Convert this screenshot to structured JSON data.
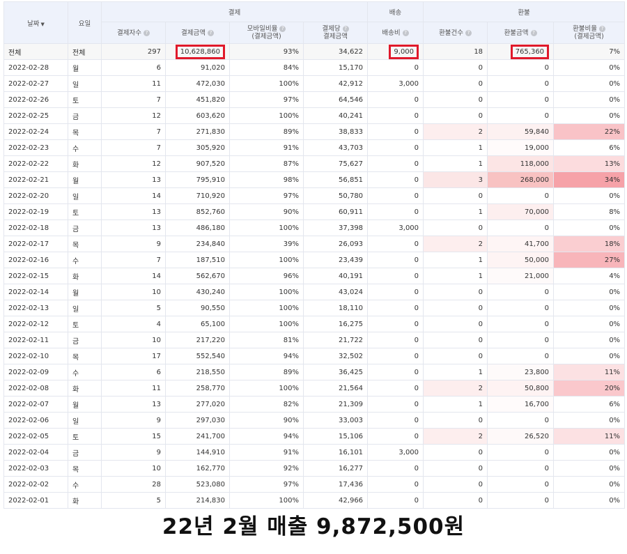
{
  "headers": {
    "date": "날짜",
    "weekday": "요일",
    "group_payment": "결제",
    "group_shipping": "배송",
    "group_refund": "환불",
    "payers": "결제자수",
    "payment_amount": "결제금액",
    "mobile_ratio_l1": "모바일비율",
    "mobile_ratio_l2": "(결제금액)",
    "per_payer_l1": "결제당",
    "per_payer_l2": "결제금액",
    "shipping_fee": "배송비",
    "refund_count": "환불건수",
    "refund_amount": "환불금액",
    "refund_ratio_l1": "환불비율",
    "refund_ratio_l2": "(결제금액)",
    "help_glyph": "?",
    "sort_glyph": "▼"
  },
  "colors": {
    "highlight_border": "#e0192b",
    "header_bg": "#eef2fb",
    "grid": "#e3e6ee"
  },
  "total": {
    "date": "전체",
    "weekday": "전체",
    "payers": "297",
    "amount": "10,628,860",
    "mobile": "93%",
    "per_payer": "34,622",
    "shipping": "9,000",
    "refund_count": "18",
    "refund_amount": "765,360",
    "refund_ratio": "7%"
  },
  "rows": [
    {
      "date": "2022-02-28",
      "weekday": "월",
      "payers": "6",
      "amount": "91,020",
      "mobile": "84%",
      "per_payer": "15,170",
      "shipping": "0",
      "refund_count": "0",
      "refund_amount": "0",
      "refund_ratio": "0%"
    },
    {
      "date": "2022-02-27",
      "weekday": "일",
      "payers": "11",
      "amount": "472,030",
      "mobile": "100%",
      "per_payer": "42,912",
      "shipping": "3,000",
      "refund_count": "0",
      "refund_amount": "0",
      "refund_ratio": "0%"
    },
    {
      "date": "2022-02-26",
      "weekday": "토",
      "payers": "7",
      "amount": "451,820",
      "mobile": "97%",
      "per_payer": "64,546",
      "shipping": "0",
      "refund_count": "0",
      "refund_amount": "0",
      "refund_ratio": "0%"
    },
    {
      "date": "2022-02-25",
      "weekday": "금",
      "payers": "12",
      "amount": "603,620",
      "mobile": "100%",
      "per_payer": "40,241",
      "shipping": "0",
      "refund_count": "0",
      "refund_amount": "0",
      "refund_ratio": "0%"
    },
    {
      "date": "2022-02-24",
      "weekday": "목",
      "payers": "7",
      "amount": "271,830",
      "mobile": "89%",
      "per_payer": "38,833",
      "shipping": "0",
      "refund_count": "2",
      "refund_amount": "59,840",
      "refund_ratio": "22%"
    },
    {
      "date": "2022-02-23",
      "weekday": "수",
      "payers": "7",
      "amount": "305,920",
      "mobile": "91%",
      "per_payer": "43,703",
      "shipping": "0",
      "refund_count": "1",
      "refund_amount": "19,000",
      "refund_ratio": "6%"
    },
    {
      "date": "2022-02-22",
      "weekday": "화",
      "payers": "12",
      "amount": "907,520",
      "mobile": "87%",
      "per_payer": "75,627",
      "shipping": "0",
      "refund_count": "1",
      "refund_amount": "118,000",
      "refund_ratio": "13%"
    },
    {
      "date": "2022-02-21",
      "weekday": "월",
      "payers": "13",
      "amount": "795,910",
      "mobile": "98%",
      "per_payer": "56,851",
      "shipping": "0",
      "refund_count": "3",
      "refund_amount": "268,000",
      "refund_ratio": "34%"
    },
    {
      "date": "2022-02-20",
      "weekday": "일",
      "payers": "14",
      "amount": "710,920",
      "mobile": "97%",
      "per_payer": "50,780",
      "shipping": "0",
      "refund_count": "0",
      "refund_amount": "0",
      "refund_ratio": "0%"
    },
    {
      "date": "2022-02-19",
      "weekday": "토",
      "payers": "13",
      "amount": "852,760",
      "mobile": "90%",
      "per_payer": "60,911",
      "shipping": "0",
      "refund_count": "1",
      "refund_amount": "70,000",
      "refund_ratio": "8%"
    },
    {
      "date": "2022-02-18",
      "weekday": "금",
      "payers": "13",
      "amount": "486,180",
      "mobile": "100%",
      "per_payer": "37,398",
      "shipping": "3,000",
      "refund_count": "0",
      "refund_amount": "0",
      "refund_ratio": "0%"
    },
    {
      "date": "2022-02-17",
      "weekday": "목",
      "payers": "9",
      "amount": "234,840",
      "mobile": "39%",
      "per_payer": "26,093",
      "shipping": "0",
      "refund_count": "2",
      "refund_amount": "41,700",
      "refund_ratio": "18%"
    },
    {
      "date": "2022-02-16",
      "weekday": "수",
      "payers": "7",
      "amount": "187,510",
      "mobile": "100%",
      "per_payer": "23,439",
      "shipping": "0",
      "refund_count": "1",
      "refund_amount": "50,000",
      "refund_ratio": "27%"
    },
    {
      "date": "2022-02-15",
      "weekday": "화",
      "payers": "14",
      "amount": "562,670",
      "mobile": "96%",
      "per_payer": "40,191",
      "shipping": "0",
      "refund_count": "1",
      "refund_amount": "21,000",
      "refund_ratio": "4%"
    },
    {
      "date": "2022-02-14",
      "weekday": "월",
      "payers": "10",
      "amount": "430,240",
      "mobile": "100%",
      "per_payer": "43,024",
      "shipping": "0",
      "refund_count": "0",
      "refund_amount": "0",
      "refund_ratio": "0%"
    },
    {
      "date": "2022-02-13",
      "weekday": "일",
      "payers": "5",
      "amount": "90,550",
      "mobile": "100%",
      "per_payer": "18,110",
      "shipping": "0",
      "refund_count": "0",
      "refund_amount": "0",
      "refund_ratio": "0%"
    },
    {
      "date": "2022-02-12",
      "weekday": "토",
      "payers": "4",
      "amount": "65,100",
      "mobile": "100%",
      "per_payer": "16,275",
      "shipping": "0",
      "refund_count": "0",
      "refund_amount": "0",
      "refund_ratio": "0%"
    },
    {
      "date": "2022-02-11",
      "weekday": "금",
      "payers": "10",
      "amount": "217,220",
      "mobile": "81%",
      "per_payer": "21,722",
      "shipping": "0",
      "refund_count": "0",
      "refund_amount": "0",
      "refund_ratio": "0%"
    },
    {
      "date": "2022-02-10",
      "weekday": "목",
      "payers": "17",
      "amount": "552,540",
      "mobile": "94%",
      "per_payer": "32,502",
      "shipping": "0",
      "refund_count": "0",
      "refund_amount": "0",
      "refund_ratio": "0%"
    },
    {
      "date": "2022-02-09",
      "weekday": "수",
      "payers": "6",
      "amount": "218,550",
      "mobile": "89%",
      "per_payer": "36,425",
      "shipping": "0",
      "refund_count": "1",
      "refund_amount": "23,800",
      "refund_ratio": "11%"
    },
    {
      "date": "2022-02-08",
      "weekday": "화",
      "payers": "11",
      "amount": "258,770",
      "mobile": "100%",
      "per_payer": "21,564",
      "shipping": "0",
      "refund_count": "2",
      "refund_amount": "50,800",
      "refund_ratio": "20%"
    },
    {
      "date": "2022-02-07",
      "weekday": "월",
      "payers": "13",
      "amount": "277,020",
      "mobile": "82%",
      "per_payer": "21,309",
      "shipping": "0",
      "refund_count": "1",
      "refund_amount": "16,700",
      "refund_ratio": "6%"
    },
    {
      "date": "2022-02-06",
      "weekday": "일",
      "payers": "9",
      "amount": "297,030",
      "mobile": "90%",
      "per_payer": "33,003",
      "shipping": "0",
      "refund_count": "0",
      "refund_amount": "0",
      "refund_ratio": "0%"
    },
    {
      "date": "2022-02-05",
      "weekday": "토",
      "payers": "15",
      "amount": "241,700",
      "mobile": "94%",
      "per_payer": "15,106",
      "shipping": "0",
      "refund_count": "2",
      "refund_amount": "26,520",
      "refund_ratio": "11%"
    },
    {
      "date": "2022-02-04",
      "weekday": "금",
      "payers": "9",
      "amount": "144,910",
      "mobile": "91%",
      "per_payer": "16,101",
      "shipping": "3,000",
      "refund_count": "0",
      "refund_amount": "0",
      "refund_ratio": "0%"
    },
    {
      "date": "2022-02-03",
      "weekday": "목",
      "payers": "10",
      "amount": "162,770",
      "mobile": "92%",
      "per_payer": "16,277",
      "shipping": "0",
      "refund_count": "0",
      "refund_amount": "0",
      "refund_ratio": "0%"
    },
    {
      "date": "2022-02-02",
      "weekday": "수",
      "payers": "28",
      "amount": "523,080",
      "mobile": "97%",
      "per_payer": "17,436",
      "shipping": "0",
      "refund_count": "0",
      "refund_amount": "0",
      "refund_ratio": "0%"
    },
    {
      "date": "2022-02-01",
      "weekday": "화",
      "payers": "5",
      "amount": "214,830",
      "mobile": "100%",
      "per_payer": "42,966",
      "shipping": "0",
      "refund_count": "0",
      "refund_amount": "0",
      "refund_ratio": "0%"
    }
  ],
  "summary": "22년 2월 매출 9,872,500원"
}
